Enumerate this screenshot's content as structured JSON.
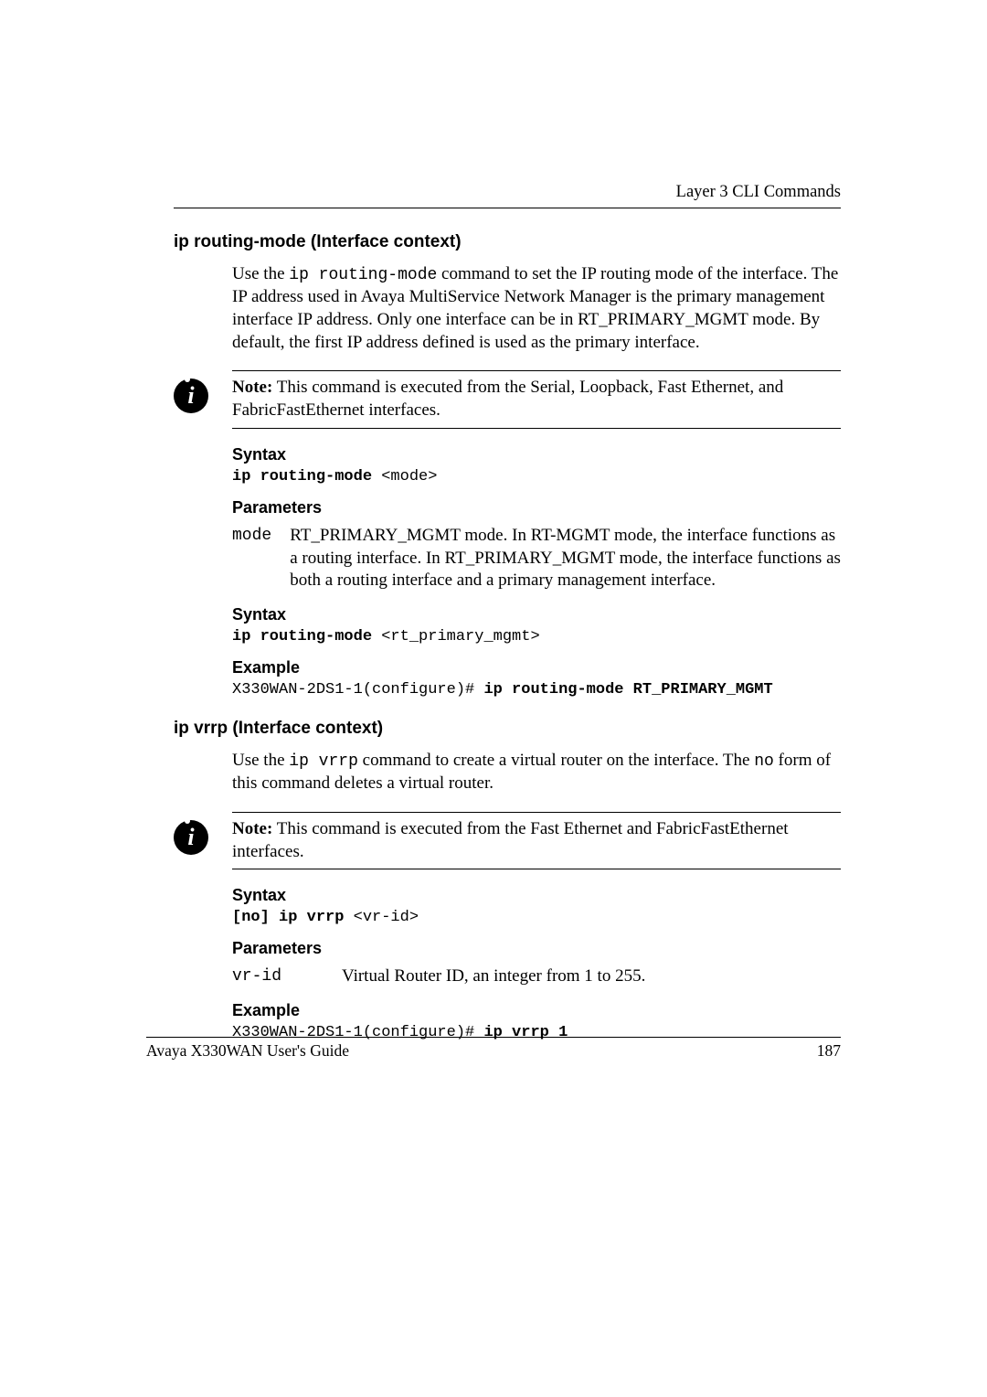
{
  "header": {
    "chapter": "Layer 3 CLI Commands"
  },
  "section1": {
    "title": "ip routing-mode (Interface context)",
    "intro_pre": "Use the ",
    "intro_cmd": "ip routing-mode",
    "intro_post": " command to set the IP routing mode of the interface. The IP address used in Avaya MultiService Network Manager is the primary management interface IP address. Only one interface can be in RT_PRIMARY_MGMT mode. By default, the first IP address defined is used as the primary interface.",
    "note_label": "Note:",
    "note_text": " This command is executed from the Serial, Loopback, Fast Ethernet, and FabricFastEthernet interfaces.",
    "syntax1_header": "Syntax",
    "syntax1_cmd": "ip routing-mode",
    "syntax1_arg": " <mode>",
    "params_header": "Parameters",
    "param_name": "mode",
    "param_desc": "RT_PRIMARY_MGMT mode. In RT-MGMT mode, the interface functions as a routing interface. In RT_PRIMARY_MGMT mode, the interface functions as both a routing interface and a primary management interface.",
    "syntax2_header": "Syntax",
    "syntax2_cmd": "ip routing-mode",
    "syntax2_arg": " <rt_primary_mgmt>",
    "example_header": "Example",
    "example_pre": "X330WAN-2DS1-1(configure)# ",
    "example_cmd": "ip routing-mode RT_PRIMARY_MGMT"
  },
  "section2": {
    "title": "ip vrrp (Interface context)",
    "intro_pre": "Use the ",
    "intro_cmd": "ip vrrp",
    "intro_mid": " command to create a virtual router on the interface. The ",
    "intro_no": "no",
    "intro_post": " form of this command deletes a virtual router.",
    "note_label": "Note:",
    "note_text": " This command is executed from the Fast Ethernet and FabricFastEthernet interfaces.",
    "syntax_header": "Syntax",
    "syntax_cmd": "[no] ip vrrp",
    "syntax_arg": " <vr-id>",
    "params_header": "Parameters",
    "param_name": "vr-id",
    "param_desc": "Virtual Router ID, an integer from 1 to 255.",
    "example_header": "Example",
    "example_pre": "X330WAN-2DS1-1(configure)# ",
    "example_cmd": "ip vrrp 1"
  },
  "footer": {
    "book": "Avaya X330WAN User's Guide",
    "page": "187"
  }
}
